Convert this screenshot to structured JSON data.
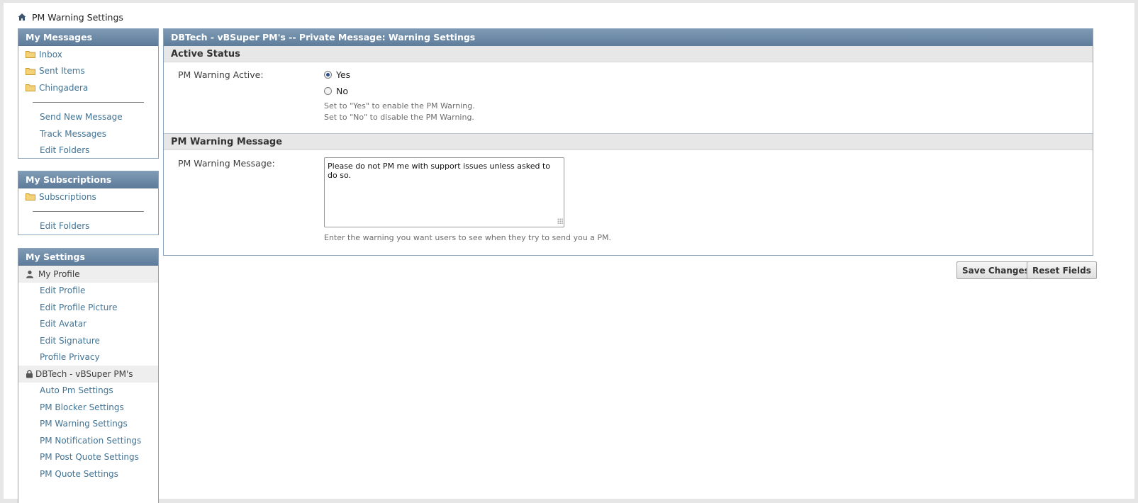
{
  "breadcrumb": {
    "title": "PM Warning Settings"
  },
  "sidebar": {
    "my_messages": {
      "title": "My Messages",
      "folders": [
        "Inbox",
        "Sent Items",
        "Chingadera"
      ],
      "links": [
        "Send New Message",
        "Track Messages",
        "Edit Folders"
      ]
    },
    "my_subscriptions": {
      "title": "My Subscriptions",
      "folders": [
        "Subscriptions"
      ],
      "links": [
        "Edit Folders"
      ]
    },
    "my_settings": {
      "title": "My Settings",
      "profile_group": "My Profile",
      "profile_links": [
        "Edit Profile",
        "Edit Profile Picture",
        "Edit Avatar",
        "Edit Signature",
        "Profile Privacy"
      ],
      "plugin_group": "DBTech - vBSuper PM's",
      "plugin_links": [
        "Auto Pm Settings",
        "PM Blocker Settings",
        "PM Warning Settings",
        "PM Notification Settings",
        "PM Post Quote Settings",
        "PM Quote Settings"
      ]
    }
  },
  "main": {
    "title": "DBTech - vBSuper PM's -- Private Message: Warning Settings",
    "active_status": {
      "section_title": "Active Status",
      "label": "PM Warning Active:",
      "options": [
        "Yes",
        "No"
      ],
      "selected": "Yes",
      "help_lines": [
        "Set to \"Yes\" to enable the PM Warning.",
        "Set to \"No\" to disable the PM Warning."
      ]
    },
    "warning_message": {
      "section_title": "PM Warning Message",
      "label": "PM Warning Message:",
      "value": "Please do not PM me with support issues unless asked to do so.",
      "help": "Enter the warning you want users to see when they try to send you a PM."
    }
  },
  "buttons": {
    "save": "Save Changes",
    "reset": "Reset Fields"
  },
  "colors": {
    "header": "#6885a2",
    "link": "#417394",
    "section_bg": "#e7e7e7"
  }
}
